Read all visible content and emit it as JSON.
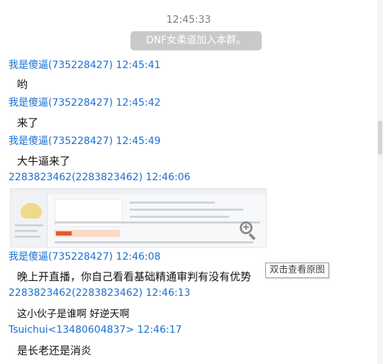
{
  "chat": {
    "timestamp": "12:45:33",
    "system_notice": "DNF女柔道加入本群。",
    "messages": [
      {
        "sender": "我是傻逼(735228427) 12:45:41",
        "text": "哟"
      },
      {
        "sender": "我是傻逼(735228427) 12:45:42",
        "text": "来了"
      },
      {
        "sender": "我是傻逼(735228427) 12:45:49",
        "text": "大牛逼来了"
      },
      {
        "sender": "2283823462(2283823462) 12:46:06",
        "text": ""
      },
      {
        "sender": "我是傻逼(735228427) 12:46:08",
        "text": "晚上开直播，你自己看看基础精通审判有没有优势"
      },
      {
        "sender": "2283823462(2283823462) 12:46:13",
        "text": "这小伙子是谁啊 好逆天啊"
      },
      {
        "sender": "Tsuichui<13480604837> 12:46:17",
        "text": "是长老还是消炎"
      }
    ],
    "image_tooltip": "双击查看原图"
  },
  "icons": {
    "zoom": "zoom-in-icon"
  },
  "colors": {
    "sender_name": "#1a6fd1",
    "system_pill": "#c9c9c9",
    "background": "#ffffff"
  }
}
